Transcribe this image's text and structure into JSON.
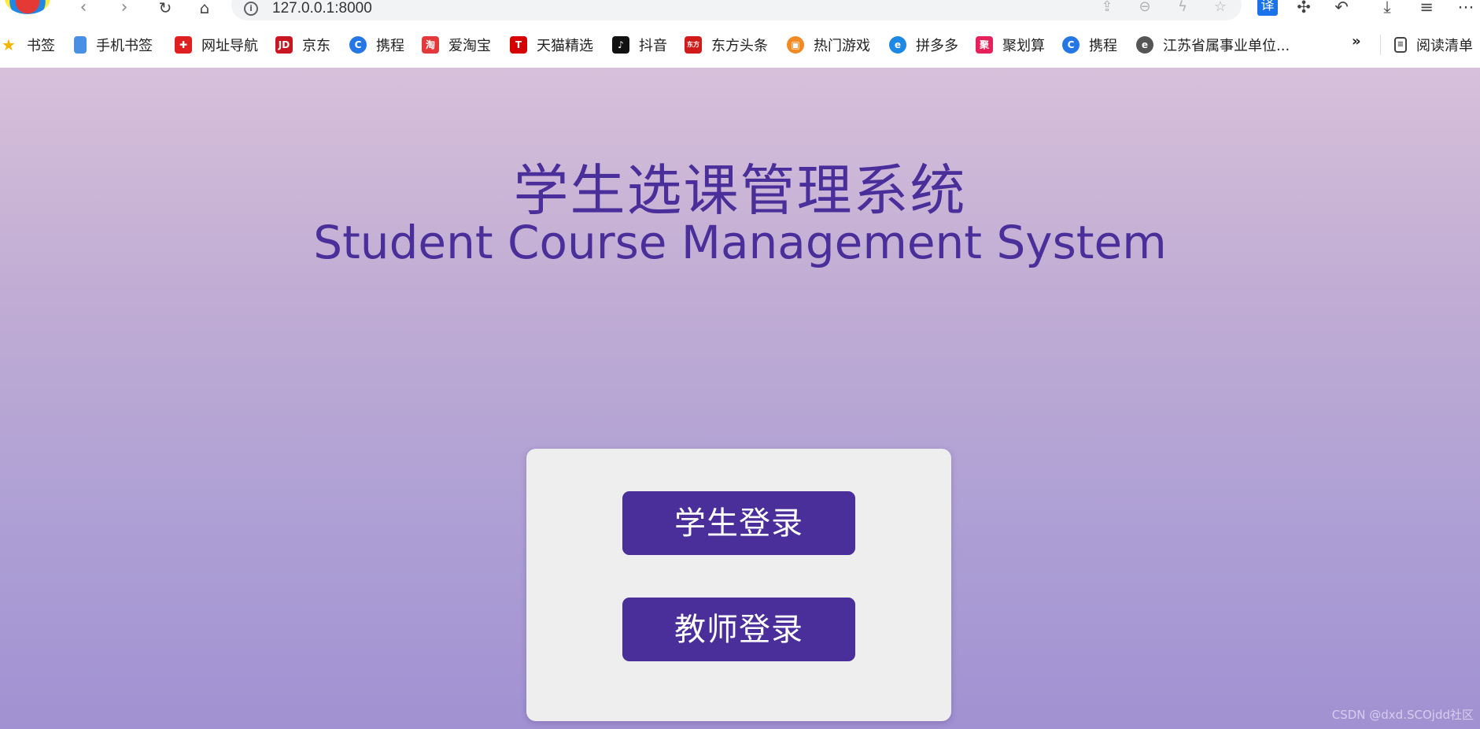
{
  "browser": {
    "url": "127.0.0.1:8000",
    "translate_label": "译"
  },
  "bookmarks": {
    "items": [
      {
        "label": "书签",
        "icon": "star-icon",
        "color": "#f5b400"
      },
      {
        "label": "手机书签",
        "icon": "phone-icon",
        "color": "#4a90e2"
      },
      {
        "label": "网址导航",
        "icon": "nav-icon",
        "color": "#e02020"
      },
      {
        "label": "京东",
        "icon": "jd-icon",
        "color": "#c91623"
      },
      {
        "label": "携程",
        "icon": "ctrip-icon",
        "color": "#2577e3"
      },
      {
        "label": "爱淘宝",
        "icon": "taobao-icon",
        "color": "#e4393c"
      },
      {
        "label": "天猫精选",
        "icon": "tmall-icon",
        "color": "#d60000"
      },
      {
        "label": "抖音",
        "icon": "douyin-icon",
        "color": "#111111"
      },
      {
        "label": "东方头条",
        "icon": "dongfang-icon",
        "color": "#d11a1a"
      },
      {
        "label": "热门游戏",
        "icon": "game-icon",
        "color": "#f08a24"
      },
      {
        "label": "拼多多",
        "icon": "pinduoduo-icon",
        "color": "#1e88e5"
      },
      {
        "label": "聚划算",
        "icon": "juhuasuan-icon",
        "color": "#e5215c"
      },
      {
        "label": "携程",
        "icon": "ctrip-icon",
        "color": "#2577e3"
      },
      {
        "label": "江苏省属事业单位...",
        "icon": "e-icon",
        "color": "#555555"
      }
    ],
    "more": "»",
    "reading_list": "阅读清单"
  },
  "main": {
    "title_cn": "学生选课管理系统",
    "title_en": "Student Course Management System",
    "student_login": "学生登录",
    "teacher_login": "教师登录"
  },
  "watermark": "CSDN @dxd.SCOjdd社区"
}
